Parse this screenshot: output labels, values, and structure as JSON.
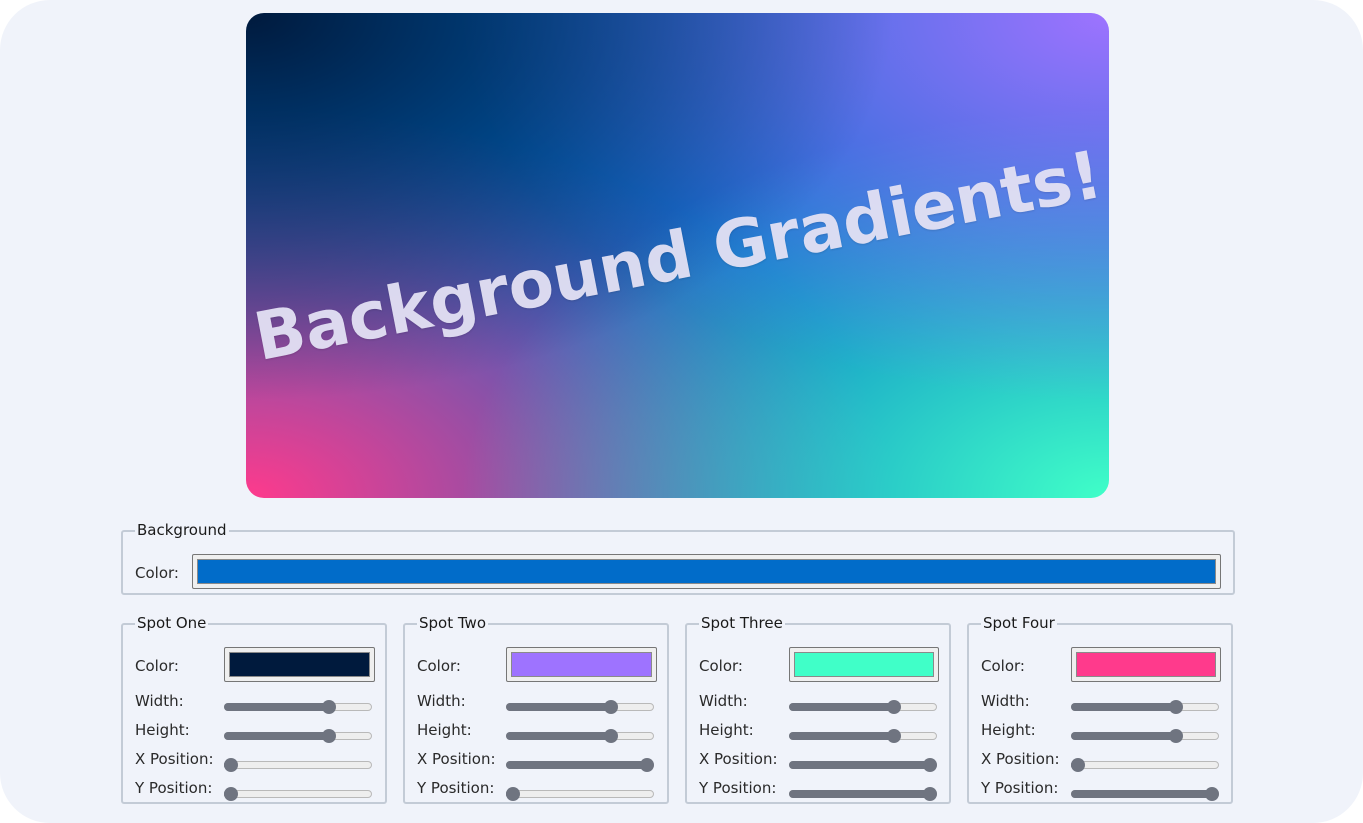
{
  "preview": {
    "headline": "Background Gradients!"
  },
  "background": {
    "legend": "Background",
    "color_label": "Color:",
    "color_value": "#016cc9"
  },
  "spots": [
    {
      "legend": "Spot One",
      "color_label": "Color:",
      "color_value": "#001a3d",
      "sliders": [
        {
          "label": "Width:",
          "value": 0.73
        },
        {
          "label": "Height:",
          "value": 0.73
        },
        {
          "label": "X Position:",
          "value": 0.0
        },
        {
          "label": "Y Position:",
          "value": 0.0
        }
      ]
    },
    {
      "legend": "Spot Two",
      "color_label": "Color:",
      "color_value": "#9e73ff",
      "sliders": [
        {
          "label": "Width:",
          "value": 0.73
        },
        {
          "label": "Height:",
          "value": 0.73
        },
        {
          "label": "X Position:",
          "value": 1.0
        },
        {
          "label": "Y Position:",
          "value": 0.0
        }
      ]
    },
    {
      "legend": "Spot Three",
      "color_label": "Color:",
      "color_value": "#40ffc8",
      "sliders": [
        {
          "label": "Width:",
          "value": 0.73
        },
        {
          "label": "Height:",
          "value": 0.73
        },
        {
          "label": "X Position:",
          "value": 1.0
        },
        {
          "label": "Y Position:",
          "value": 1.0
        }
      ]
    },
    {
      "legend": "Spot Four",
      "color_label": "Color:",
      "color_value": "#ff3a8c",
      "sliders": [
        {
          "label": "Width:",
          "value": 0.73
        },
        {
          "label": "Height:",
          "value": 0.73
        },
        {
          "label": "X Position:",
          "value": 0.0
        },
        {
          "label": "Y Position:",
          "value": 1.0
        }
      ]
    }
  ]
}
